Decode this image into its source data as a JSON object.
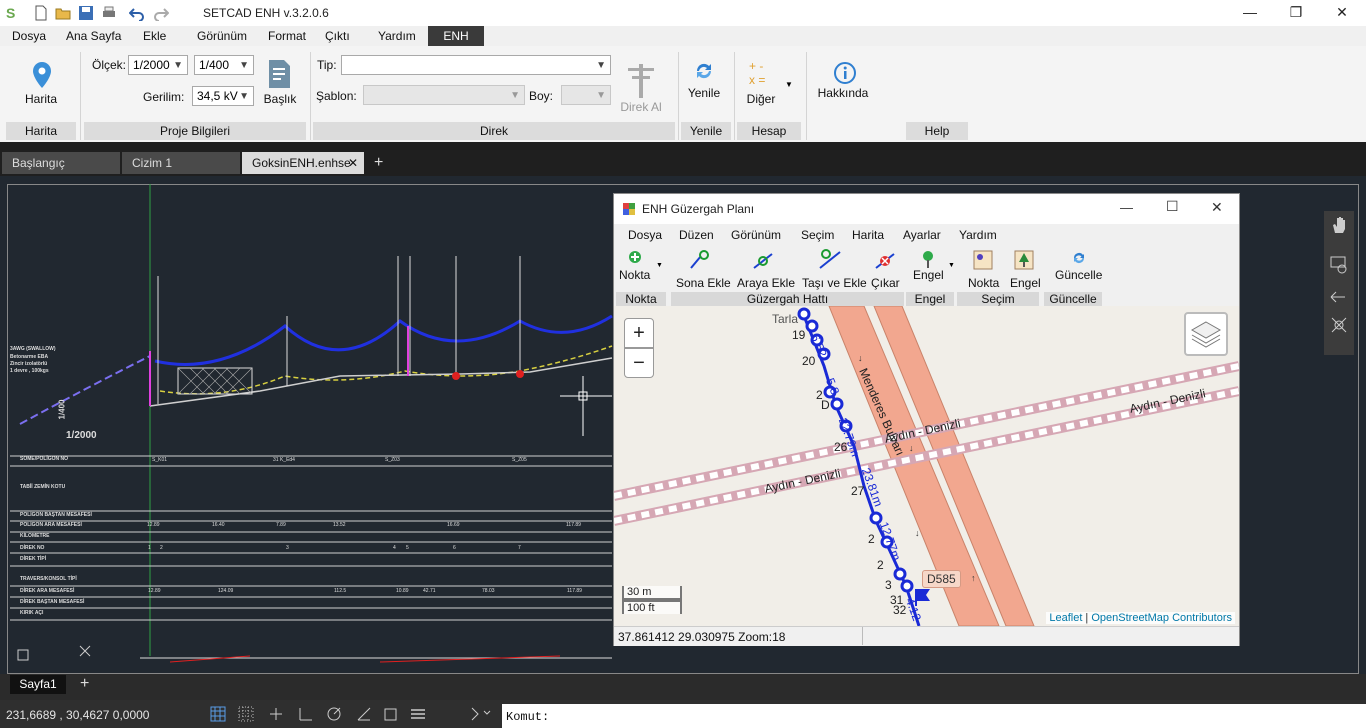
{
  "app": {
    "title": "SETCAD ENH v.3.2.0.6",
    "menus": [
      "Dosya",
      "Ana Sayfa",
      "Ekle",
      "Görünüm",
      "Format",
      "Çıktı",
      "Yardım",
      "ENH"
    ]
  },
  "ribbon": {
    "harita_btn": "Harita",
    "olcek_label": "Ölçek:",
    "olcek_value": "1/2000",
    "olcek2_value": "1/400",
    "gerilim_label": "Gerilim:",
    "gerilim_value": "34,5 kV",
    "baslik_btn": "Başlık",
    "tip_label": "Tip:",
    "tip_value": "",
    "sablon_label": "Şablon:",
    "sablon_value": "",
    "boy_label": "Boy:",
    "boy_value": "",
    "direk_al_btn": "Direk Al",
    "yenile_btn": "Yenile",
    "diger_btn": "Diğer",
    "hakkinda_btn": "Hakkında",
    "groups": [
      "Harita",
      "Proje Bilgileri",
      "Direk",
      "Yenile",
      "Hesap",
      "Help"
    ]
  },
  "doc_tabs": [
    "Başlangıç",
    "Cizim 1",
    "GoksinENH.enhse"
  ],
  "cad": {
    "poles_top": [
      "S_K01",
      "31 K_Ed4",
      "S_Z03",
      "S_Z05"
    ],
    "side_notes": [
      "3AWG (SWALLOW)",
      "Betonarme EBA",
      "Zincir izolatörlü",
      "1 devre , 100kgs"
    ],
    "scale_text": "1/2000",
    "vscale": "1/400",
    "rows": [
      "SOME/POLİGON NO",
      "TABİİ ZEMİN KOTU",
      "POLİGON BAŞTAN MESAFESİ",
      "POLİGON ARA MESAFESİ",
      "KİLOMETRE",
      "DİREK NO",
      "DİREK TİPİ",
      "TRAVERS/KONSOL TİPİ",
      "DİREK ARA MESAFESİ",
      "DİREK BAŞTAN MESAFESİ",
      "KIRIK AÇI"
    ],
    "row1_vals": [
      "S_K01",
      "31 K_Ed4",
      "S_Z03",
      "S_Z05"
    ],
    "ara_mesafe": [
      "12.89",
      "16.40",
      "7.89",
      "13.52",
      "16.69",
      "117.89"
    ],
    "direk_no": [
      "1",
      "2",
      "3",
      "4",
      "5",
      "6",
      "7"
    ],
    "direk_ara": [
      "12.89",
      "124.09",
      "112.5",
      "10.89",
      "42.71",
      "78.03",
      "117.89"
    ]
  },
  "sheet_tab": "Sayfa1",
  "status": {
    "coords": "231,6689 , 30,4627  0,0000",
    "command_label": "Komut:"
  },
  "dialog": {
    "title": "ENH Güzergah Planı",
    "menus": [
      "Dosya",
      "Düzen",
      "Görünüm",
      "Seçim",
      "Harita",
      "Ayarlar",
      "Yardım"
    ],
    "tools": [
      "Nokta",
      "Sona Ekle",
      "Araya Ekle",
      "Taşı ve Ekle",
      "Çıkar",
      "Engel",
      "Nokta",
      "Engel",
      "Güncelle"
    ],
    "groups": [
      "Nokta",
      "Güzergah Hattı",
      "Engel",
      "Seçim",
      "Güncelle"
    ],
    "map": {
      "street1": "Menderes Bulvarı",
      "rail1": "Aydın - Denizli",
      "rail2": "Aydın - Denizli",
      "rail3": "Aydın - Denizli",
      "road_badge": "D585",
      "field_label": "Tarla",
      "point_labels": [
        "19",
        "20",
        "2",
        "D",
        "26",
        "27",
        "2",
        "2",
        "3",
        "31",
        "32"
      ],
      "seg_labels": [
        "6.52",
        "5.8",
        "22.79m",
        "23.81m",
        "12.77m",
        "4.12"
      ],
      "scale_m": "30 m",
      "scale_ft": "100 ft",
      "attribution_leaflet": "Leaflet",
      "attribution_sep": " | ",
      "attribution_osm": "OpenStreetMap Contributors"
    },
    "status": "37.861412 29.030975 Zoom:18"
  }
}
